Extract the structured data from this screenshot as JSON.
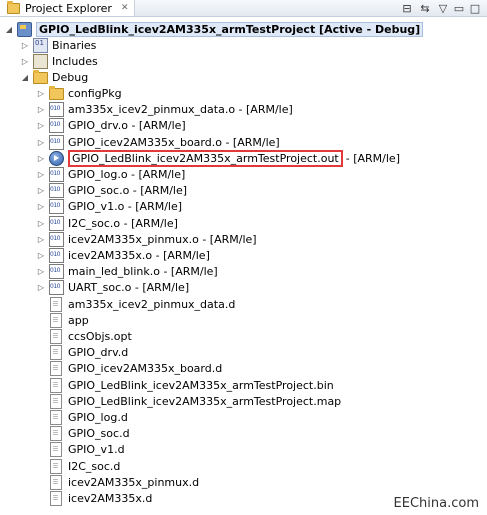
{
  "tab": {
    "title": "Project Explorer",
    "close": "✕"
  },
  "toolbar": {
    "collapse_icon": "⊟",
    "link_icon": "⇆",
    "menu_icon": "▽",
    "minimize_icon": "▭",
    "maximize_icon": "□"
  },
  "tree": {
    "project": "GPIO_LedBlink_icev2AM335x_armTestProject  [Active - Debug]",
    "binaries": "Binaries",
    "includes": "Includes",
    "debug": "Debug",
    "items": [
      "configPkg",
      "am335x_icev2_pinmux_data.o - [ARM/le]",
      "GPIO_drv.o - [ARM/le]",
      "GPIO_icev2AM335x_board.o - [ARM/le]",
      "GPIO_LedBlink_icev2AM335x_armTestProject.out",
      "GPIO_log.o - [ARM/le]",
      "GPIO_soc.o - [ARM/le]",
      "GPIO_v1.o - [ARM/le]",
      "I2C_soc.o - [ARM/le]",
      "icev2AM335x_pinmux.o - [ARM/le]",
      "icev2AM335x.o - [ARM/le]",
      "main_led_blink.o - [ARM/le]",
      "UART_soc.o - [ARM/le]",
      "am335x_icev2_pinmux_data.d",
      "app",
      "ccsObjs.opt",
      "GPIO_drv.d",
      "GPIO_icev2AM335x_board.d",
      "GPIO_LedBlink_icev2AM335x_armTestProject.bin",
      "GPIO_LedBlink_icev2AM335x_armTestProject.map",
      "GPIO_log.d",
      "GPIO_soc.d",
      "GPIO_v1.d",
      "I2C_soc.d",
      "icev2AM335x_pinmux.d",
      "icev2AM335x.d"
    ],
    "out_suffix": "- [ARM/le]"
  },
  "watermark": "EEChina.com",
  "colors": {
    "highlight_box": "#e23a3a",
    "selection": "#dfe8f6"
  }
}
